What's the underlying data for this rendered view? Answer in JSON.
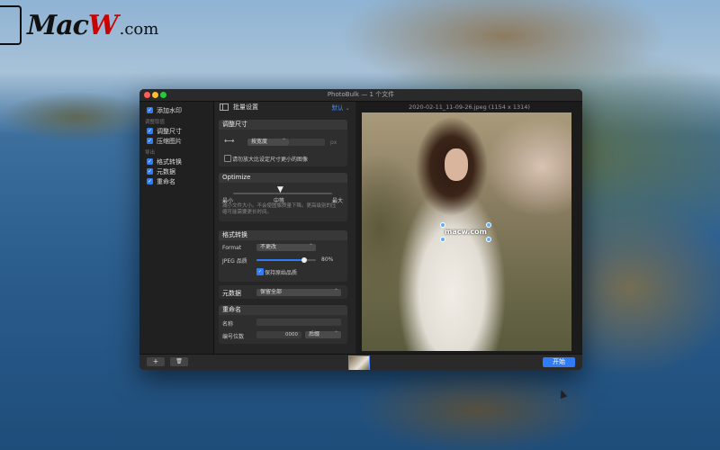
{
  "branding": {
    "logo_main": "MacW",
    "logo_suffix": ".com"
  },
  "window": {
    "title": "PhotoBulk — 1 个文件"
  },
  "sidebar": {
    "items": [
      {
        "label": "添加水印",
        "checked": true
      },
      {
        "group": "调整取值"
      },
      {
        "label": "调整尺寸",
        "checked": true
      },
      {
        "label": "压缩图片",
        "checked": true
      },
      {
        "group": "导出"
      },
      {
        "label": "格式转换",
        "checked": true
      },
      {
        "label": "元数据",
        "checked": true
      },
      {
        "label": "重命名",
        "checked": true
      }
    ]
  },
  "settings": {
    "header": "批量设置",
    "preset": "默认 ⌄",
    "resize": {
      "title": "调整尺寸",
      "mode": "按宽度",
      "unit": "px",
      "enlarge_label": "请勿放大比设定尺寸更小的图像"
    },
    "optimize": {
      "title": "Optimize",
      "min_label": "最小",
      "mid_label": "中等",
      "max_label": "最大",
      "desc": "减小文件大小。不会使图像质量下降。更高级别的压缩可能需要更长时间。"
    },
    "format": {
      "title": "格式转换",
      "format_label": "Format",
      "format_value": "不更改",
      "jpeg_label": "JPEG 品质",
      "jpeg_value": "80%",
      "jpeg_quality": 80,
      "keep_label": "保持原始品质"
    },
    "metadata": {
      "label": "元数据",
      "value": "保留全部"
    },
    "rename": {
      "title": "重命名",
      "name_label": "名称",
      "digits_label": "编号位数",
      "digits_value": "0000",
      "position_value": "后缀"
    }
  },
  "preview": {
    "filename": "2020-02-11_11-09-26.jpeg (1154 x 1314)",
    "watermark": "macw.com"
  },
  "bottombar": {
    "add": "+",
    "delete": "🗑",
    "start": "开始"
  },
  "colors": {
    "accent": "#2f7cf6",
    "window_bg": "#1e1e1e"
  }
}
